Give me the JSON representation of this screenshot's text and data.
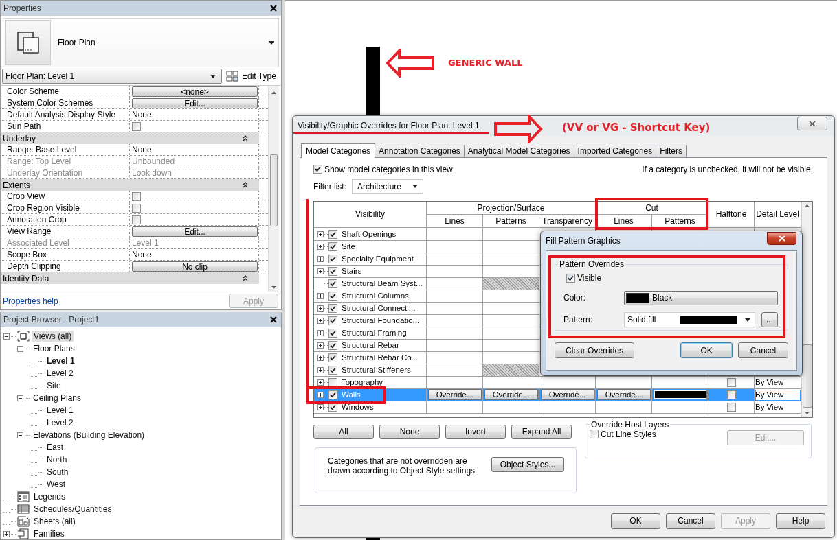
{
  "properties": {
    "title": "Properties",
    "type_name": "Floor Plan",
    "instance": "Floor Plan: Level 1",
    "edit_type": "Edit Type",
    "rows": [
      {
        "kind": "button",
        "label": "Color Scheme",
        "value": "<none>",
        "disabled": false
      },
      {
        "kind": "button",
        "label": "System Color Schemes",
        "value": "Edit...",
        "disabled": false
      },
      {
        "kind": "text",
        "label": "Default Analysis Display Style",
        "value": "None",
        "disabled": false
      },
      {
        "kind": "checkbox",
        "label": "Sun Path",
        "checked": false,
        "disabled": false
      },
      {
        "kind": "group",
        "label": "Underlay",
        "expanded": true
      },
      {
        "kind": "text",
        "label": "Range: Base Level",
        "value": "None",
        "disabled": false
      },
      {
        "kind": "text",
        "label": "Range: Top Level",
        "value": "Unbounded",
        "disabled": true
      },
      {
        "kind": "text",
        "label": "Underlay Orientation",
        "value": "Look down",
        "disabled": true
      },
      {
        "kind": "group",
        "label": "Extents",
        "expanded": true
      },
      {
        "kind": "checkbox",
        "label": "Crop View",
        "checked": false,
        "disabled": false
      },
      {
        "kind": "checkbox",
        "label": "Crop Region Visible",
        "checked": false,
        "disabled": false
      },
      {
        "kind": "checkbox",
        "label": "Annotation Crop",
        "checked": false,
        "disabled": false
      },
      {
        "kind": "button",
        "label": "View Range",
        "value": "Edit...",
        "disabled": false
      },
      {
        "kind": "text",
        "label": "Associated Level",
        "value": "Level 1",
        "disabled": true
      },
      {
        "kind": "text",
        "label": "Scope Box",
        "value": "None",
        "disabled": false
      },
      {
        "kind": "button",
        "label": "Depth Clipping",
        "value": "No clip",
        "disabled": false
      },
      {
        "kind": "group",
        "label": "Identity Data",
        "expanded": true
      }
    ],
    "help_link": "Properties help",
    "apply": {
      "label": "Apply",
      "disabled": true
    }
  },
  "project_browser": {
    "title": "Project Browser - Project1",
    "tree": [
      {
        "label": "Views (all)",
        "kind": "views",
        "expanded": true,
        "selected": true,
        "current": false,
        "children": [
          {
            "label": "Floor Plans",
            "expanded": true,
            "selected": false,
            "current": false,
            "children": [
              {
                "label": "Level 1",
                "selected": false,
                "current": true
              },
              {
                "label": "Level 2",
                "selected": false,
                "current": false
              },
              {
                "label": "Site",
                "selected": false,
                "current": false
              }
            ]
          },
          {
            "label": "Ceiling Plans",
            "expanded": true,
            "selected": false,
            "current": false,
            "children": [
              {
                "label": "Level 1",
                "selected": false,
                "current": false
              },
              {
                "label": "Level 2",
                "selected": false,
                "current": false
              }
            ]
          },
          {
            "label": "Elevations (Building Elevation)",
            "expanded": true,
            "selected": false,
            "current": false,
            "children": [
              {
                "label": "East",
                "selected": false,
                "current": false
              },
              {
                "label": "North",
                "selected": false,
                "current": false
              },
              {
                "label": "South",
                "selected": false,
                "current": false
              },
              {
                "label": "West",
                "selected": false,
                "current": false
              }
            ]
          }
        ]
      },
      {
        "label": "Legends",
        "kind": "legends",
        "selected": false,
        "current": false
      },
      {
        "label": "Schedules/Quantities",
        "kind": "schedules",
        "selected": false,
        "current": false
      },
      {
        "label": "Sheets (all)",
        "kind": "sheets",
        "selected": false,
        "current": false
      },
      {
        "label": "Families",
        "kind": "families",
        "expanded": false,
        "selected": false,
        "current": false
      }
    ]
  },
  "annotations": [
    {
      "text": "GENERIC WALL"
    },
    {
      "text": "(VV or VG - Shortcut Key)"
    }
  ],
  "vg_dialog": {
    "title": "Visibility/Graphic Overrides for Floor Plan: Level 1",
    "tabs": [
      {
        "label": "Model Categories",
        "selected": true
      },
      {
        "label": "Annotation Categories",
        "selected": false
      },
      {
        "label": "Analytical Model Categories",
        "selected": false
      },
      {
        "label": "Imported Categories",
        "selected": false
      },
      {
        "label": "Filters",
        "selected": false
      }
    ],
    "show_categories": {
      "label": "Show model categories in this view",
      "checked": true
    },
    "hint": "If a category is unchecked, it will not be visible.",
    "filter_label": "Filter list:",
    "filter_value": "Architecture",
    "headers": {
      "visibility": "Visibility",
      "projection": "Projection/Surface",
      "cut": "Cut",
      "halftone": "Halftone",
      "detail_level": "Detail Level"
    },
    "subcolumns": [
      "Lines",
      "Patterns",
      "Transparency",
      "Lines",
      "Patterns"
    ],
    "rows": [
      {
        "name": "Shaft Openings",
        "visible": true,
        "expandable": true,
        "selected": false,
        "patterns_unavailable": false,
        "cut_pattern_override": false
      },
      {
        "name": "Site",
        "visible": true,
        "expandable": true,
        "selected": false,
        "patterns_unavailable": false,
        "cut_pattern_override": false
      },
      {
        "name": "Specialty Equipment",
        "visible": true,
        "expandable": true,
        "selected": false,
        "patterns_unavailable": false,
        "cut_pattern_override": false
      },
      {
        "name": "Stairs",
        "visible": true,
        "expandable": true,
        "selected": false,
        "patterns_unavailable": false,
        "cut_pattern_override": false
      },
      {
        "name": "Structural Beam Syst...",
        "visible": true,
        "expandable": false,
        "selected": false,
        "patterns_unavailable": true,
        "cut_pattern_override": false
      },
      {
        "name": "Structural Columns",
        "visible": true,
        "expandable": true,
        "selected": false,
        "patterns_unavailable": false,
        "cut_pattern_override": false
      },
      {
        "name": "Structural Connecti...",
        "visible": true,
        "expandable": true,
        "selected": false,
        "patterns_unavailable": false,
        "cut_pattern_override": false
      },
      {
        "name": "Structural Foundatio...",
        "visible": true,
        "expandable": true,
        "selected": false,
        "patterns_unavailable": false,
        "cut_pattern_override": false
      },
      {
        "name": "Structural Framing",
        "visible": true,
        "expandable": true,
        "selected": false,
        "patterns_unavailable": false,
        "cut_pattern_override": false
      },
      {
        "name": "Structural Rebar",
        "visible": true,
        "expandable": true,
        "selected": false,
        "patterns_unavailable": false,
        "cut_pattern_override": false
      },
      {
        "name": "Structural Rebar Co...",
        "visible": true,
        "expandable": true,
        "selected": false,
        "patterns_unavailable": false,
        "cut_pattern_override": false
      },
      {
        "name": "Structural Stiffeners",
        "visible": true,
        "expandable": true,
        "selected": false,
        "patterns_unavailable": true,
        "cut_pattern_override": false
      },
      {
        "name": "Topography",
        "visible": false,
        "expandable": true,
        "selected": false,
        "patterns_unavailable": false,
        "cut_pattern_override": false,
        "halftone": false,
        "detail_level": "By View"
      },
      {
        "name": "Walls",
        "visible": true,
        "expandable": true,
        "selected": true,
        "patterns_unavailable": false,
        "overrides": [
          "Override...",
          "Override...",
          "Override...",
          "Override..."
        ],
        "cut_pattern_override": true,
        "halftone": false,
        "detail_level": "By View"
      },
      {
        "name": "Windows",
        "visible": true,
        "expandable": true,
        "selected": false,
        "patterns_unavailable": false,
        "cut_pattern_override": false,
        "halftone": false,
        "detail_level": "By View"
      }
    ],
    "row_buttons": [
      "All",
      "None",
      "Invert",
      "Expand All"
    ],
    "note": "Categories that are not overridden are drawn according to Object Style settings.",
    "object_styles": "Object Styles...",
    "host_layers": {
      "title": "Override Host Layers",
      "checkbox": {
        "label": "Cut Line Styles",
        "checked": false
      },
      "edit": {
        "label": "Edit...",
        "disabled": true
      }
    },
    "footer": [
      {
        "label": "OK",
        "disabled": false
      },
      {
        "label": "Cancel",
        "disabled": false
      },
      {
        "label": "Apply",
        "disabled": true
      },
      {
        "label": "Help",
        "disabled": false
      }
    ]
  },
  "fill_dialog": {
    "title": "Fill Pattern Graphics",
    "group": "Pattern Overrides",
    "visible": {
      "label": "Visible",
      "checked": true
    },
    "color_label": "Color:",
    "color_name": "Black",
    "color": "#000000",
    "pattern_label": "Pattern:",
    "pattern_name": "Solid fill",
    "browse": "...",
    "buttons": [
      {
        "label": "Clear Overrides",
        "default": false
      },
      {
        "label": "OK",
        "default": true
      },
      {
        "label": "Cancel",
        "default": false
      }
    ]
  }
}
